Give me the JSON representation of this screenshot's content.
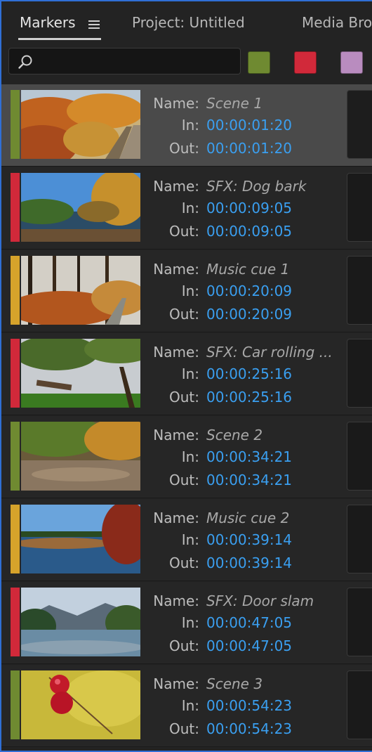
{
  "tabs": [
    {
      "label": "Markers",
      "active": true
    },
    {
      "label": "Project: Untitled",
      "active": false
    },
    {
      "label": "Media Bro",
      "active": false
    }
  ],
  "search": {
    "placeholder": "",
    "value": ""
  },
  "filter_swatches": [
    {
      "name": "green",
      "color": "#6f8a31"
    },
    {
      "name": "red",
      "color": "#d1293a"
    },
    {
      "name": "violet",
      "color": "#b98cbf"
    }
  ],
  "field_labels": {
    "name": "Name:",
    "in": "In:",
    "out": "Out:"
  },
  "markers": [
    {
      "color": "#6f8a31",
      "name": "Scene 1",
      "in": "00:00:01:20",
      "out": "00:00:01:20",
      "selected": true,
      "thumb": "autumn-path"
    },
    {
      "color": "#d1293a",
      "name": "SFX: Dog bark",
      "in": "00:00:09:05",
      "out": "00:00:09:05",
      "selected": false,
      "thumb": "lake-trees"
    },
    {
      "color": "#d6a32b",
      "name": "Music cue 1",
      "in": "00:00:20:09",
      "out": "00:00:20:09",
      "selected": false,
      "thumb": "forest-trail"
    },
    {
      "color": "#d1293a",
      "name": "SFX: Car rolling ...",
      "in": "00:00:25:16",
      "out": "00:00:25:16",
      "selected": false,
      "thumb": "tree-bench"
    },
    {
      "color": "#6f8a31",
      "name": "Scene 2",
      "in": "00:00:34:21",
      "out": "00:00:34:21",
      "selected": false,
      "thumb": "riverbed"
    },
    {
      "color": "#d6a32b",
      "name": "Music cue 2",
      "in": "00:00:39:14",
      "out": "00:00:39:14",
      "selected": false,
      "thumb": "marsh-lake"
    },
    {
      "color": "#d1293a",
      "name": "SFX: Door slam",
      "in": "00:00:47:05",
      "out": "00:00:47:05",
      "selected": false,
      "thumb": "mountain-river"
    },
    {
      "color": "#6f8a31",
      "name": "Scene 3",
      "in": "00:00:54:23",
      "out": "00:00:54:23",
      "selected": false,
      "thumb": "red-berries"
    }
  ]
}
